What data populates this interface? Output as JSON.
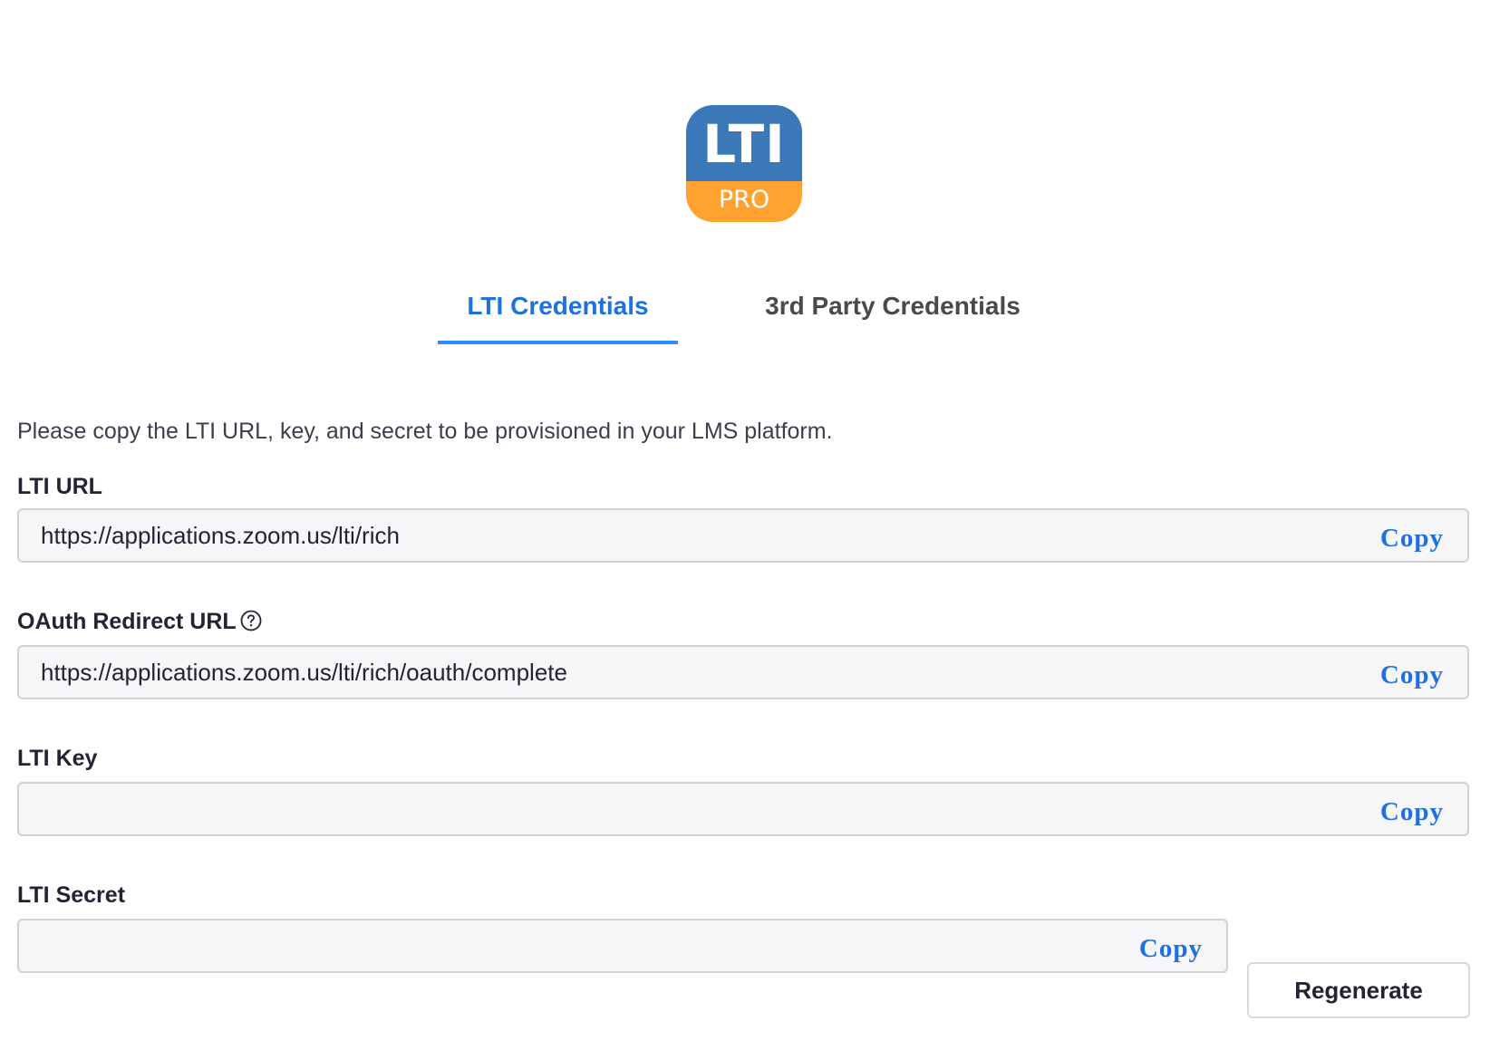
{
  "logo": {
    "main_text": "LTI",
    "sub_text": "PRO",
    "top_color": "#3a78b7",
    "bottom_color": "#ffa230"
  },
  "tabs": [
    {
      "label": "LTI Credentials",
      "active": true
    },
    {
      "label": "3rd Party Credentials",
      "active": false
    }
  ],
  "accent_color": "#2d8cff",
  "instructions": "Please copy the LTI URL, key, and secret to be provisioned in your LMS platform.",
  "fields": {
    "lti_url": {
      "label": "LTI URL",
      "value": "https://applications.zoom.us/lti/rich",
      "copy_label": "Copy"
    },
    "oauth_redirect_url": {
      "label": "OAuth Redirect URL",
      "help_icon": "question-circle-icon",
      "value": "https://applications.zoom.us/lti/rich/oauth/complete",
      "copy_label": "Copy"
    },
    "lti_key": {
      "label": "LTI Key",
      "value": "",
      "copy_label": "Copy"
    },
    "lti_secret": {
      "label": "LTI Secret",
      "value": "",
      "copy_label": "Copy",
      "regenerate_label": "Regenerate"
    }
  }
}
